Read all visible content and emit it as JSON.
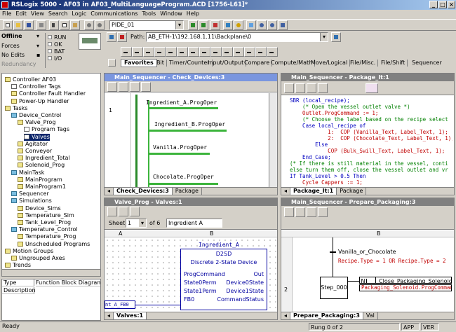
{
  "window": {
    "title": "RSLogix 5000 - AF03 in AF03_MultiLanguageProgram.ACD [1756-L61]*"
  },
  "menu": [
    "File",
    "Edit",
    "View",
    "Search",
    "Logic",
    "Communications",
    "Tools",
    "Window",
    "Help"
  ],
  "toolbar": {
    "routine_select": "PIDE_01",
    "path_label": "Path:",
    "path_value": "AB_ETH-1\\192.168.1.11\\Backplane\\0"
  },
  "controller_status": {
    "mode": "Offline",
    "forces": "Forces",
    "edits": "No Edits",
    "redundancy": "Redundancy",
    "run": "RUN",
    "ok": "OK",
    "bat": "BAT",
    "io": "I/O"
  },
  "instr_tabs": [
    "Favorites",
    "Bit",
    "Timer/Counter",
    "Input/Output",
    "Compare",
    "Compute/Math",
    "Move/Logical",
    "File/Misc.",
    "File/Shift",
    "Sequencer"
  ],
  "tree": {
    "items": [
      {
        "label": "Controller AF03",
        "indent": 0,
        "icon": "folder"
      },
      {
        "label": "Controller Tags",
        "indent": 1,
        "icon": "doc"
      },
      {
        "label": "Controller Fault Handler",
        "indent": 1,
        "icon": "folder"
      },
      {
        "label": "Power-Up Handler",
        "indent": 1,
        "icon": "folder"
      },
      {
        "label": "Tasks",
        "indent": 0,
        "icon": "folder"
      },
      {
        "label": "Device_Control",
        "indent": 1,
        "icon": "prog"
      },
      {
        "label": "Valve_Prog",
        "indent": 2,
        "icon": "folder"
      },
      {
        "label": "Program Tags",
        "indent": 3,
        "icon": "doc"
      },
      {
        "label": "Valves",
        "indent": 3,
        "icon": "doc",
        "selected": true
      },
      {
        "label": "Agitator",
        "indent": 2,
        "icon": "folder"
      },
      {
        "label": "Conveyor",
        "indent": 2,
        "icon": "folder"
      },
      {
        "label": "Ingredient_Total",
        "indent": 2,
        "icon": "folder"
      },
      {
        "label": "Solenoid_Prog",
        "indent": 2,
        "icon": "folder"
      },
      {
        "label": "MainTask",
        "indent": 1,
        "icon": "prog"
      },
      {
        "label": "MainProgram",
        "indent": 2,
        "icon": "folder"
      },
      {
        "label": "MainProgram1",
        "indent": 2,
        "icon": "folder"
      },
      {
        "label": "Sequencer",
        "indent": 1,
        "icon": "prog"
      },
      {
        "label": "Simulations",
        "indent": 1,
        "icon": "prog"
      },
      {
        "label": "Device_Sims",
        "indent": 2,
        "icon": "folder"
      },
      {
        "label": "Temperature_Sim",
        "indent": 2,
        "icon": "folder"
      },
      {
        "label": "Tank_Level_Prog",
        "indent": 2,
        "icon": "folder"
      },
      {
        "label": "Temperature_Control",
        "indent": 1,
        "icon": "prog"
      },
      {
        "label": "Temperature_Prog",
        "indent": 2,
        "icon": "folder"
      },
      {
        "label": "Unscheduled Programs",
        "indent": 2,
        "icon": "folder"
      },
      {
        "label": "Motion Groups",
        "indent": 0,
        "icon": "folder"
      },
      {
        "label": "Ungrouped Axes",
        "indent": 1,
        "icon": "folder"
      },
      {
        "label": "Trends",
        "indent": 0,
        "icon": "folder"
      }
    ],
    "props": {
      "type_label": "Type",
      "type_value": "Function Block Diagram (",
      "desc_label": "Description"
    }
  },
  "win1": {
    "title": "Main_Sequencer - Check_Devices:3",
    "rung": "1",
    "ops": [
      "Ingredient_A.ProgOper",
      "Ingredient_B.ProgOper",
      "Vanilla.ProgOper",
      "Chocolate.ProgOper"
    ],
    "tabs": [
      "Check_Devices:3",
      "Package"
    ]
  },
  "win2": {
    "title": "Main_Sequencer - Package_It:1",
    "lines": [
      "SBR (local_recipe);",
      "    (* Open the vessel outlet valve *)",
      "    Outlet.ProgCommand := 1;",
      "    (* Choose the label based on the recipe select",
      "    Case local_recipe of",
      "            1:  COP (Vanilla_Text, Label_Text, 1);",
      "            2:  COP (Chocolate_Text, Label_Text, 1);",
      "        Else",
      "            COP (Bulk_Swill_Text, Label_Text, 1);",
      "    End_Case;",
      "(* If there is still material in the vessel, conti",
      "else turn them off, close the vessel outlet and vr",
      "If Tank_Level > 0.5 Then",
      "    Cycle Cappers := 1;"
    ],
    "tabs": [
      "Package_It:1",
      "Package"
    ]
  },
  "win3": {
    "title": "Valve_Prog - Valves:1",
    "sheet_label": "Sheet",
    "sheet_value": "1",
    "of_label": "of 6",
    "sheet_name": "Ingredient A",
    "col_a": "A",
    "col_b": "B",
    "block": {
      "tag": "Ingredient_A",
      "type": "D2SD",
      "desc": "Discrete 2-State Device",
      "pins_in": [
        "ProgCommand",
        "State0Perm",
        "State1Perm",
        "FB0"
      ],
      "pins_out": [
        "Out",
        "Device0State",
        "Device1State",
        "CommandStatus"
      ],
      "input_tag": "nt_A_FB0"
    },
    "tabs": [
      "Valves:1"
    ]
  },
  "win4": {
    "title": "Main_Sequencer - Prepare_Packaging:3",
    "col": "B",
    "row": "2",
    "cond1": "Vanilla_or_Chocolate",
    "cond1_expr": "Recipe.Type = 1 OR Recipe.Type = 2",
    "step": "Step_000",
    "action_q": "N",
    "action_tag": "Close_Packaging_Solenoid",
    "action_expr": "Packaging_Solenoid.ProgComman",
    "tabs": [
      "Prepare_Packaging:3",
      "Val"
    ]
  },
  "status": {
    "left": "Ready",
    "rung": "Rung 0 of 2",
    "app": "APP",
    "ver": "VER"
  },
  "colors": {
    "title_active": "#0a246a",
    "panel_title": "#7a96df",
    "rung": "#3cb43c",
    "st_keyword": "#0000c0",
    "st_comment": "#008000",
    "st_text": "#c00000",
    "block": "#0000a0"
  }
}
